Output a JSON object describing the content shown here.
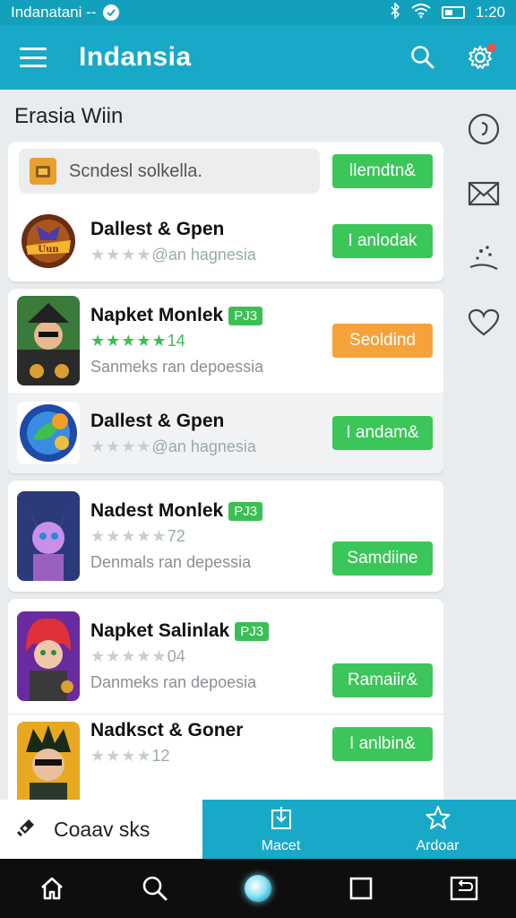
{
  "status_bar": {
    "carrier": "Indanatani --",
    "time": "1:20"
  },
  "app_bar": {
    "title": "Indansia"
  },
  "section_heading": "Erasia Wiin",
  "search": {
    "value": "Scndesl solkella.",
    "button": "llemdtn&"
  },
  "items": [
    {
      "name": "Dallest & Gpen",
      "tag": "",
      "stars_filled": 0,
      "rating_text": "@an hagnesia",
      "sub": "",
      "button": "I anlodak",
      "button_color": "#3bc65a"
    },
    {
      "name": "Napket Monlek",
      "tag": "PJ3",
      "stars_filled": 5,
      "rating_text": "14",
      "sub": "Sanmeks ran depoessia",
      "button": "Seoldind",
      "button_color": "#f6a23a"
    },
    {
      "name": "Dallest & Gpen",
      "tag": "",
      "stars_filled": 0,
      "rating_text": "@an hagnesia",
      "sub": "",
      "button": "I andam&",
      "button_color": "#3bc65a"
    },
    {
      "name": "Nadest Monlek",
      "tag": "PJ3",
      "stars_filled": 0,
      "rating_text": "72",
      "sub": "Denmals ran depessia",
      "button": "Samdiine",
      "button_color": "#3bc65a"
    },
    {
      "name": "Napket Salinlak",
      "tag": "PJ3",
      "stars_filled": 0,
      "rating_text": "04",
      "sub": "Danmeks ran depoesia",
      "button": "Ramaiir&",
      "button_color": "#3bc65a"
    },
    {
      "name": "Nadksct & Goner",
      "tag": "",
      "stars_filled": 0,
      "rating_text": "12",
      "sub": "",
      "button": "I anlbin&",
      "button_color": "#3bc65a"
    }
  ],
  "bottom_tabs": {
    "home_label": "Coaav sks",
    "tab1_label": "Macet",
    "tab2_label": "Ardoar"
  },
  "icons": [
    "menu-icon",
    "search-icon",
    "settings-icon",
    "clock-icon",
    "mail-icon",
    "sparkle-icon",
    "heart-icon",
    "puzzle-icon",
    "download-icon",
    "star-icon",
    "home-icon",
    "square-icon",
    "back-icon"
  ],
  "colors": {
    "primary": "#19a9c8",
    "green": "#3bc65a",
    "orange": "#f6a23a",
    "notification": "#f05050"
  }
}
